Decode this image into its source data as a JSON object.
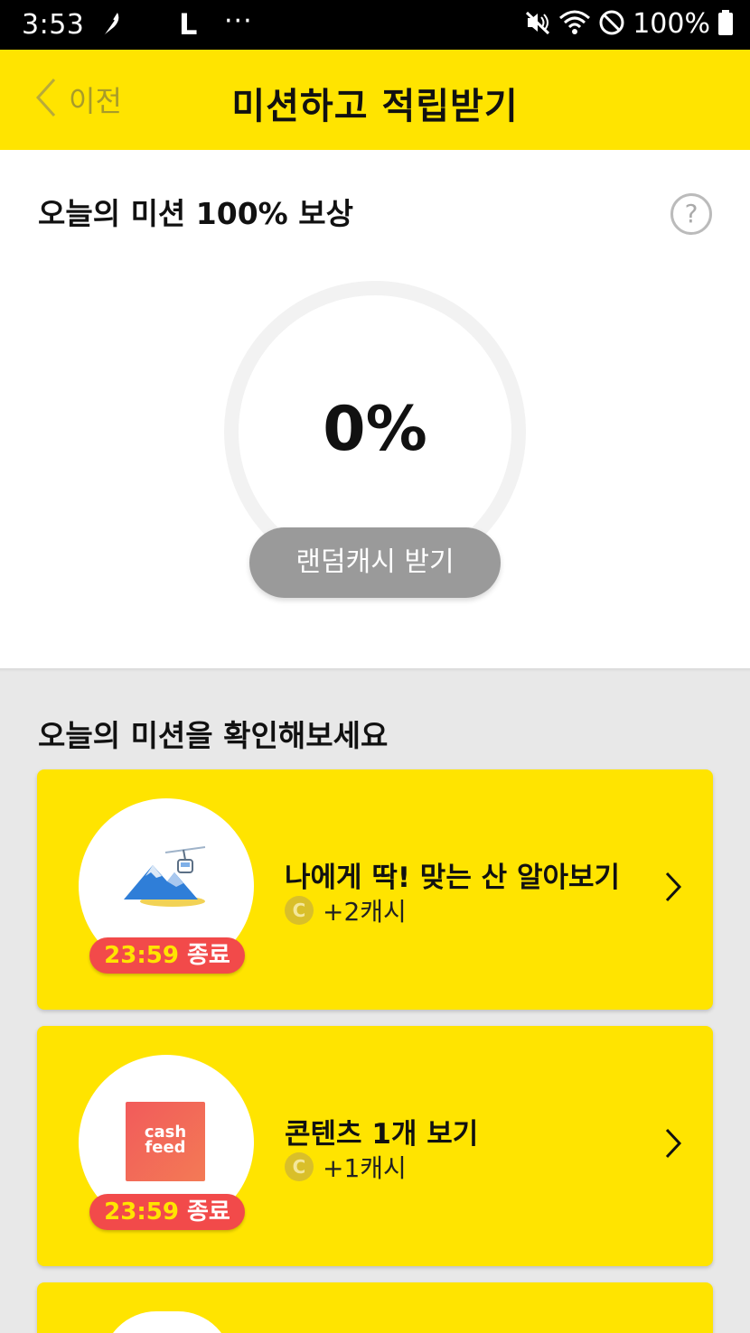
{
  "status_bar": {
    "time": "3:53",
    "launcher_letter": "L",
    "more_dots": "···",
    "battery_percent": "100%",
    "icons": [
      "feather-icon",
      "mute-icon",
      "wifi-icon",
      "blocked-icon",
      "battery-icon"
    ]
  },
  "header": {
    "back_label": "이전",
    "title": "미션하고 적립받기",
    "background_color": "#ffe400"
  },
  "reward_card": {
    "title": "오늘의 미션 100% 보상",
    "help_symbol": "?",
    "progress_percent_text": "0%",
    "progress_value": 0,
    "button_label": "랜덤캐시 받기"
  },
  "missions_section": {
    "title": "오늘의 미션을 확인해보세요",
    "missions": [
      {
        "title": "나에게 딱! 맞는 산 알아보기",
        "reward": "+2캐시",
        "coin_symbol": "C",
        "badge_time": "23:59",
        "badge_suffix": "종료",
        "thumbnail_icon": "mountain-icon"
      },
      {
        "title": "콘텐츠 1개 보기",
        "reward": "+1캐시",
        "coin_symbol": "C",
        "badge_time": "23:59",
        "badge_suffix": "종료",
        "thumbnail_logo_line1": "cash",
        "thumbnail_logo_line2": "feed"
      }
    ]
  }
}
